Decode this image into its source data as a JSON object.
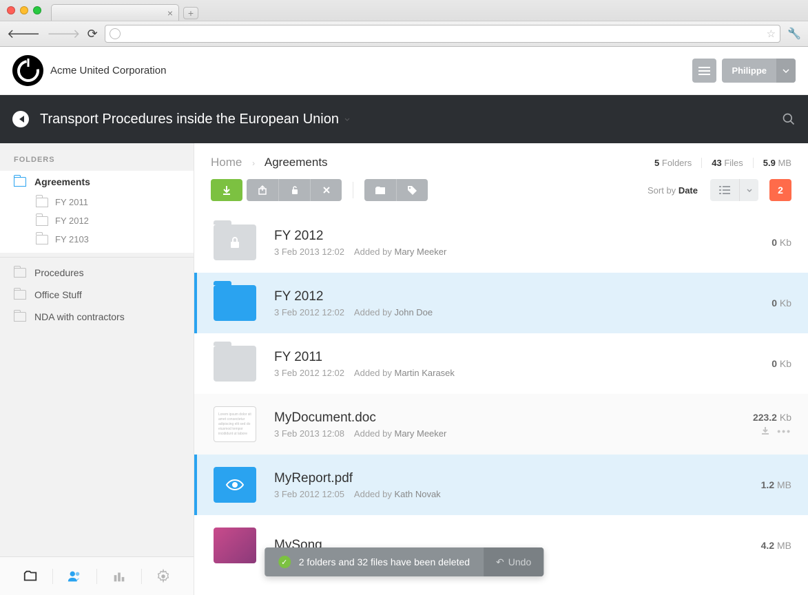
{
  "header": {
    "company": "Acme United Corporation",
    "user": "Philippe"
  },
  "darkbar": {
    "title": "Transport Procedures inside the European Union"
  },
  "sidebar": {
    "heading": "FOLDERS",
    "active": "Agreements",
    "subs": [
      "FY 2011",
      "FY 2012",
      "FY 2103"
    ],
    "items": [
      "Procedures",
      "Office Stuff",
      "NDA with contractors"
    ]
  },
  "breadcrumb": {
    "root": "Home",
    "current": "Agreements"
  },
  "stats": {
    "folders_n": "5",
    "folders_l": "Folders",
    "files_n": "43",
    "files_l": "Files",
    "size_n": "5.9",
    "size_l": "MB"
  },
  "toolbar": {
    "sort_prefix": "Sort by",
    "sort_field": "Date",
    "count": "2"
  },
  "rows": [
    {
      "title": "FY 2012",
      "date": "3 Feb 2013 12:02",
      "added": "Added by",
      "author": "Mary Meeker",
      "size_n": "0",
      "size_u": "Kb"
    },
    {
      "title": "FY 2012",
      "date": "3 Feb 2012 12:02",
      "added": "Added by",
      "author": "John Doe",
      "size_n": "0",
      "size_u": "Kb"
    },
    {
      "title": "FY 2011",
      "date": "3 Feb 2012 12:02",
      "added": "Added by",
      "author": "Martin Karasek",
      "size_n": "0",
      "size_u": "Kb"
    },
    {
      "title": "MyDocument.doc",
      "date": "3 Feb 2013 12:08",
      "added": "Added by",
      "author": "Mary Meeker",
      "size_n": "223.2",
      "size_u": "Kb"
    },
    {
      "title": "MyReport.pdf",
      "date": "3 Feb 2012 12:05",
      "added": "Added by",
      "author": "Kath Novak",
      "size_n": "1.2",
      "size_u": "MB"
    },
    {
      "title": "MySong",
      "date": "",
      "added": "",
      "author": "",
      "size_n": "4.2",
      "size_u": "MB"
    }
  ],
  "toast": {
    "message": "2 folders and 32 files have been deleted",
    "undo": "Undo"
  }
}
